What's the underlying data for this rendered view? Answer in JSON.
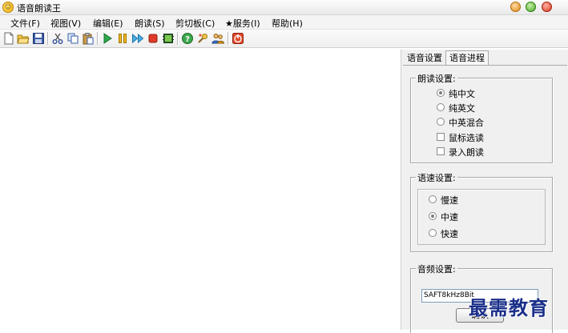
{
  "window": {
    "title": "语音朗读王"
  },
  "menu": [
    {
      "label": "文件(F)"
    },
    {
      "label": "视图(V)"
    },
    {
      "label": "编辑(E)"
    },
    {
      "label": "朗读(S)"
    },
    {
      "label": "剪切板(C)"
    },
    {
      "label": "★服务(I)"
    },
    {
      "label": "帮助(H)"
    }
  ],
  "toolbar": {
    "icons": [
      "new-file-icon",
      "open-folder-icon",
      "save-icon",
      "cut-icon",
      "copy-icon",
      "paste-icon",
      "play-icon",
      "pause-icon",
      "fast-forward-icon",
      "stop-icon",
      "record-icon",
      "help-icon",
      "tools-icon",
      "users-icon",
      "power-icon"
    ]
  },
  "tabs": [
    {
      "label": "语音设置"
    },
    {
      "label": "语音进程"
    }
  ],
  "reading_settings": {
    "legend": "朗读设置:",
    "options": [
      {
        "label": "纯中文",
        "type": "radio",
        "selected": true
      },
      {
        "label": "纯英文",
        "type": "radio",
        "selected": false
      },
      {
        "label": "中英混合",
        "type": "radio",
        "selected": false
      },
      {
        "label": "鼠标选读",
        "type": "checkbox",
        "checked": false
      },
      {
        "label": "录入朗读",
        "type": "checkbox",
        "checked": false
      }
    ]
  },
  "speed_settings": {
    "legend": "语速设置:",
    "options": [
      {
        "label": "慢速",
        "selected": false
      },
      {
        "label": "中速",
        "selected": true
      },
      {
        "label": "快速",
        "selected": false
      }
    ]
  },
  "audio_settings": {
    "legend": "音频设置:",
    "format_value": "SAFT8kHz8Bit",
    "confirm_label": "确认"
  },
  "watermark": "最需教育"
}
